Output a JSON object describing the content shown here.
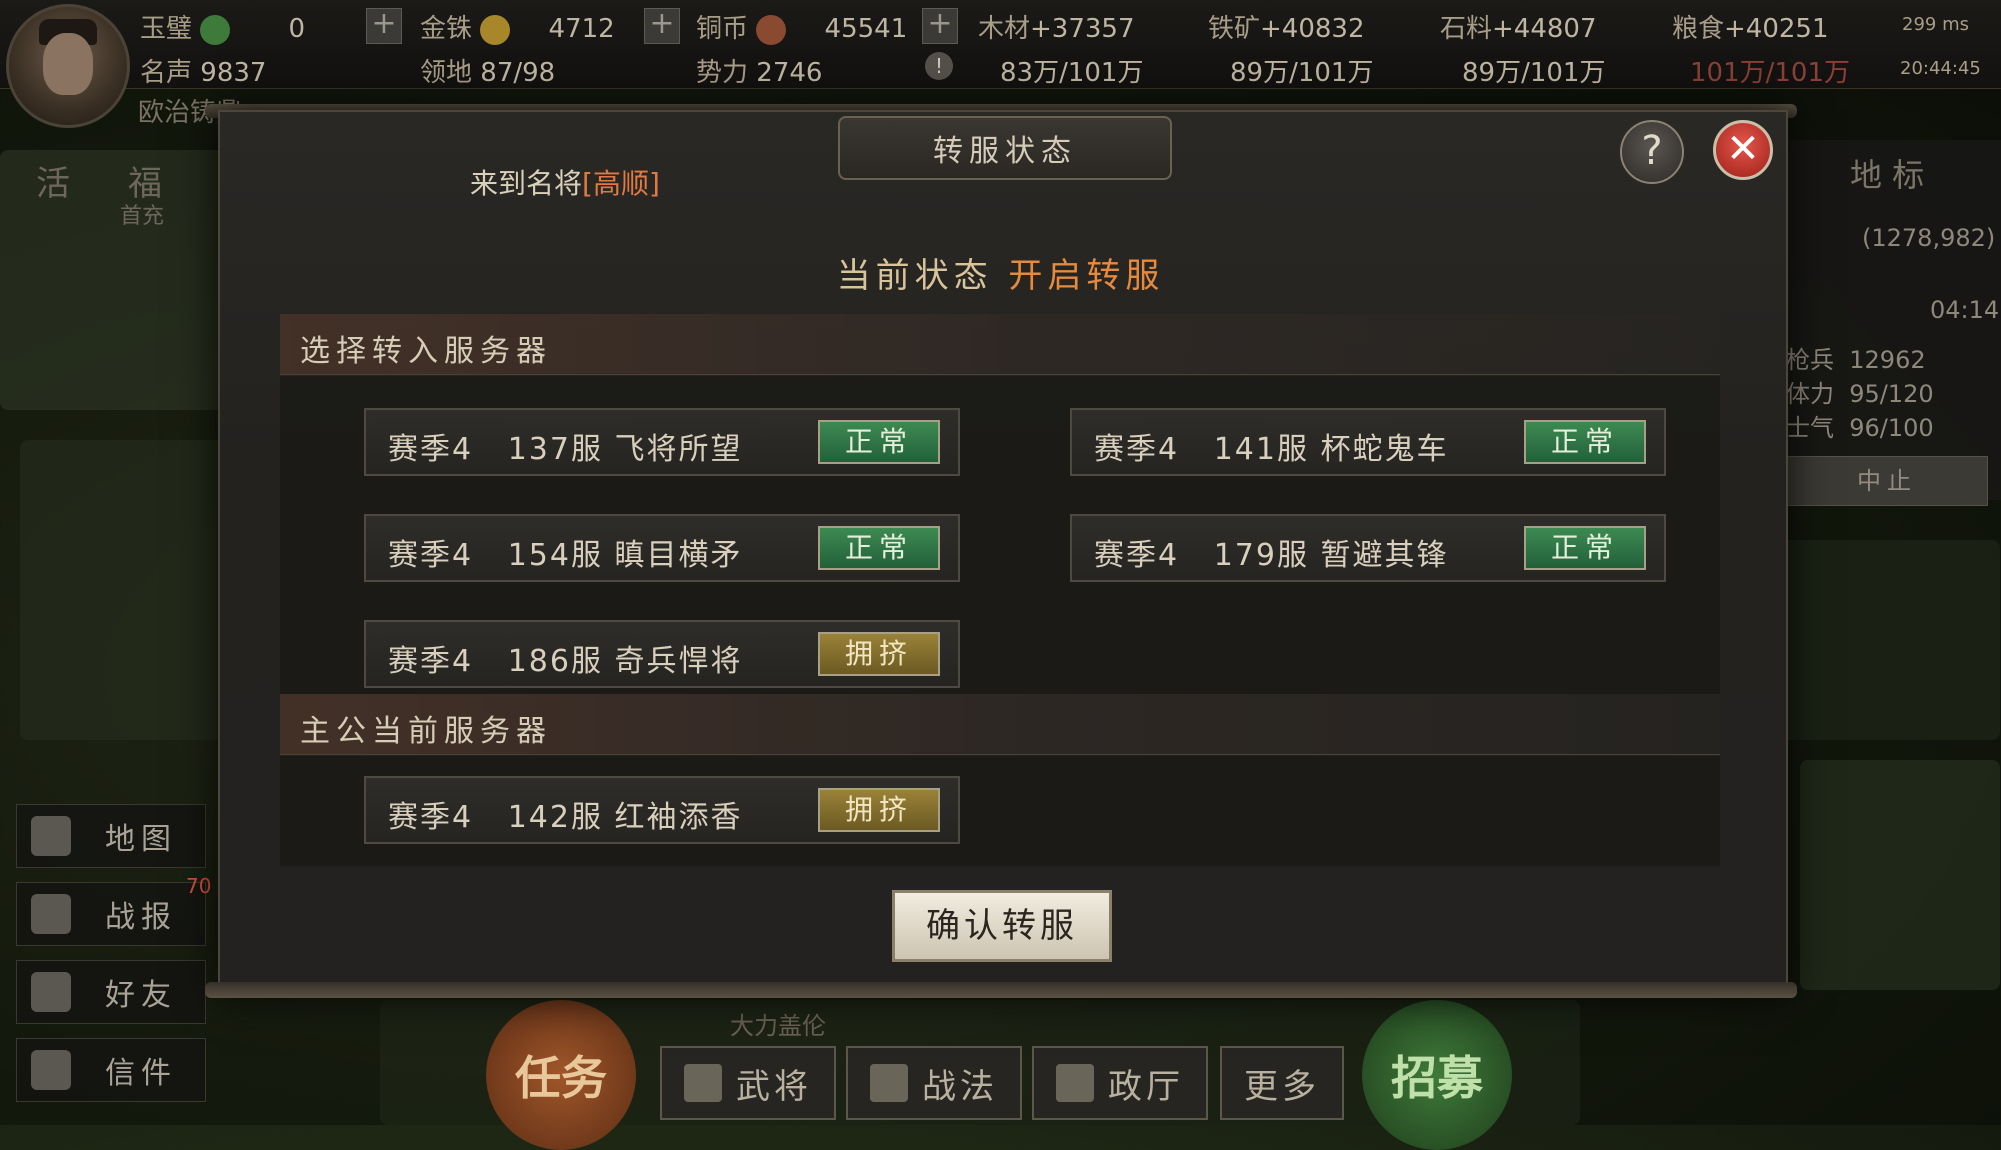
{
  "top_bar": {
    "resources_row1": [
      {
        "label": "玉璧",
        "value": "0",
        "icon": "jade-icon"
      },
      {
        "label": "金铢",
        "value": "4712",
        "icon": "gold-coin-icon"
      },
      {
        "label": "铜币",
        "value": "45541",
        "icon": "copper-coin-icon"
      },
      {
        "label": "木材",
        "value": "+37357"
      },
      {
        "label": "铁矿",
        "value": "+40832"
      },
      {
        "label": "石料",
        "value": "+44807"
      },
      {
        "label": "粮食",
        "value": "+40251"
      }
    ],
    "wifi": "299 ms",
    "resources_row2": [
      {
        "label": "名声",
        "value": "9837"
      },
      {
        "label": "领地",
        "value": "87/98"
      },
      {
        "label": "势力",
        "value": "2746"
      },
      {
        "value": "83万/101万"
      },
      {
        "value": "89万/101万"
      },
      {
        "value": "89万/101万"
      },
      {
        "value": "101万/101万"
      }
    ],
    "time": "20:44:45",
    "player_title": "欧治铸鼎"
  },
  "left_panel": {
    "top_labels": [
      "活",
      "福"
    ],
    "top_sub": "首充",
    "buttons": [
      {
        "label": "地图",
        "icon": "map-pin-icon"
      },
      {
        "label": "战报",
        "icon": "crossed-swords-icon"
      },
      {
        "label": "好友",
        "icon": "friends-icon"
      },
      {
        "label": "信件",
        "icon": "mail-icon"
      }
    ],
    "badge": "70"
  },
  "right_panel": {
    "tab": "地 标",
    "coords": "(1278,982)",
    "timer": "04:14",
    "stats": [
      {
        "label": "枪兵",
        "value": "12962"
      },
      {
        "label": "体力",
        "value": "95/120"
      },
      {
        "label": "士气",
        "value": "96/100"
      }
    ],
    "stop_button": "中止"
  },
  "bottom_bar": {
    "task_button": "任务",
    "recruit_button": "招募",
    "buttons": [
      "武将",
      "战法",
      "政厅",
      "更多"
    ],
    "under_text": "大力盖伦"
  },
  "modal": {
    "title": "转服状态",
    "marquee_prefix": "来到名将",
    "marquee_highlight": "[高顺]",
    "status_label": "当前状态",
    "status_value": "开启转服",
    "target_section": "选择转入服务器",
    "target_servers": [
      {
        "season": "赛季4",
        "name": "137服 飞将所望",
        "status": "正常",
        "type": "normal"
      },
      {
        "season": "赛季4",
        "name": "141服 杯蛇鬼车",
        "status": "正常",
        "type": "normal"
      },
      {
        "season": "赛季4",
        "name": "154服 瞋目横矛",
        "status": "正常",
        "type": "normal"
      },
      {
        "season": "赛季4",
        "name": "179服 暂避其锋",
        "status": "正常",
        "type": "normal"
      },
      {
        "season": "赛季4",
        "name": "186服 奇兵悍将",
        "status": "拥挤",
        "type": "crowded"
      }
    ],
    "current_section": "主公当前服务器",
    "current_server": {
      "season": "赛季4",
      "name": "142服 红袖添香",
      "status": "拥挤",
      "type": "crowded"
    },
    "confirm_button": "确认转服"
  },
  "colors": {
    "normal_tag": "#2f7a46",
    "crowded_tag": "#8a7230",
    "status_highlight": "#e68a3e",
    "close_button": "#c8332a"
  }
}
